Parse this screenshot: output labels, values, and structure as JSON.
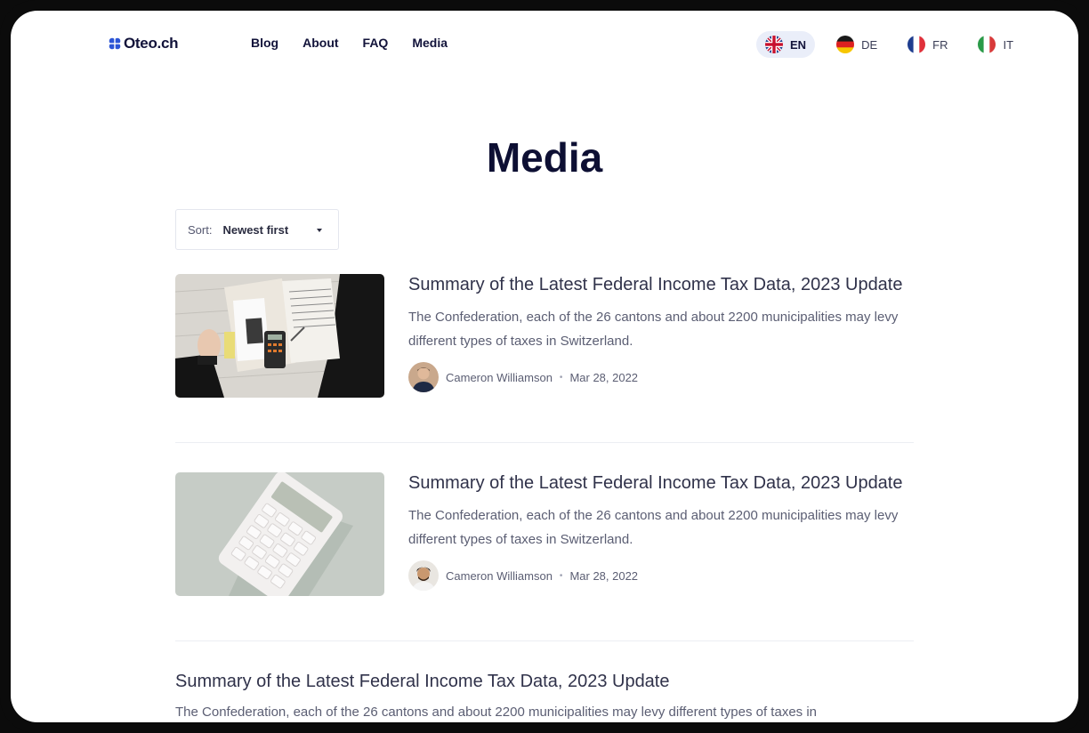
{
  "brand": {
    "name": "Oteo.ch",
    "logo_icon": "four-petal-logo",
    "accent": "#2c55d6"
  },
  "nav": {
    "items": [
      {
        "label": "Blog"
      },
      {
        "label": "About"
      },
      {
        "label": "FAQ"
      },
      {
        "label": "Media"
      }
    ]
  },
  "languages": {
    "active": "EN",
    "items": [
      {
        "code": "EN",
        "flag": "uk-flag-icon"
      },
      {
        "code": "DE",
        "flag": "germany-flag-icon"
      },
      {
        "code": "FR",
        "flag": "france-flag-icon"
      },
      {
        "code": "IT",
        "flag": "italy-flag-icon"
      }
    ]
  },
  "page": {
    "title": "Media"
  },
  "sort": {
    "label": "Sort:",
    "value": "Newest first"
  },
  "articles": [
    {
      "title": "Summary of the Latest Federal Income Tax Data, 2023 Update",
      "excerpt": "The Confederation, each of the 26 cantons and about 2200 municipalities may levy different types of taxes in Switzerland.",
      "author": "Cameron Williamson",
      "date": "Mar 28, 2022",
      "image": "tax-documents-photo"
    },
    {
      "title": "Summary of the Latest Federal Income Tax Data, 2023 Update",
      "excerpt": "The Confederation, each of the 26 cantons and about 2200 municipalities may levy different types of taxes in Switzerland.",
      "author": "Cameron Williamson",
      "date": "Mar 28, 2022",
      "image": "white-calculator-photo"
    },
    {
      "title": "Summary of the Latest Federal Income Tax Data, 2023 Update",
      "excerpt": "The Confederation, each of the 26 cantons and about 2200 municipalities may levy different types of taxes in"
    }
  ],
  "meta_separator": "•"
}
